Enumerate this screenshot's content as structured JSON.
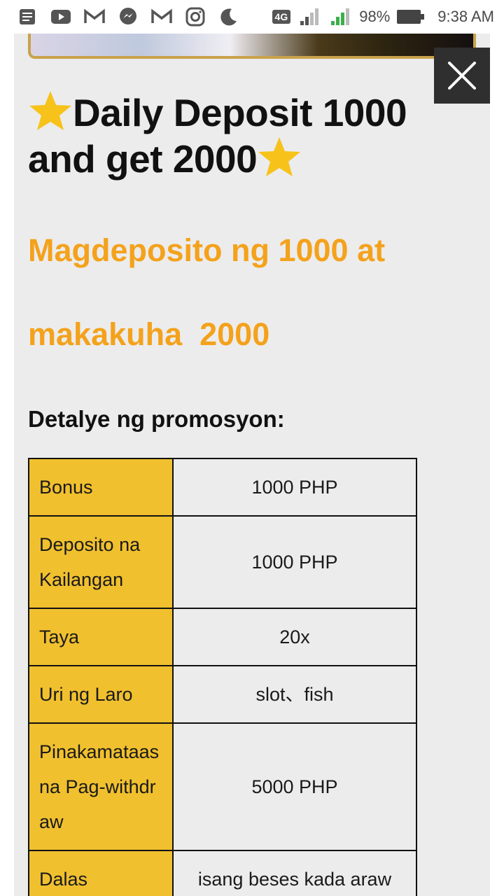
{
  "status_bar": {
    "icons": [
      "notes-icon",
      "youtube-icon",
      "gmail-icon",
      "messenger-icon",
      "gmail-icon",
      "instagram-icon",
      "do-not-disturb-moon-icon"
    ],
    "network": "4G",
    "battery": "98%",
    "time": "9:38 AM"
  },
  "promo": {
    "title": "Daily Deposit 1000 and get 2000",
    "subtitle_line1": "Magdeposito ng 1000 at",
    "subtitle_line2": "makakuha  2000",
    "details_heading": "Detalye ng promosyon:"
  },
  "table": {
    "rows": [
      {
        "label": "Bonus",
        "value": "1000 PHP"
      },
      {
        "label": "Deposito na Kailangan",
        "value": "1000 PHP"
      },
      {
        "label": "Taya",
        "value": "20x"
      },
      {
        "label": "Uri ng Laro",
        "value": "slot、fish"
      },
      {
        "label": "Pinakamataas na Pag-withdraw",
        "value": "5000 PHP"
      },
      {
        "label": "Dalas",
        "value": "isang beses kada araw"
      }
    ]
  },
  "colors": {
    "accent_orange": "#f4a21c",
    "label_yellow": "#f0c02e",
    "panel_gray": "#ececec",
    "close_bg": "#2f2f2f"
  }
}
